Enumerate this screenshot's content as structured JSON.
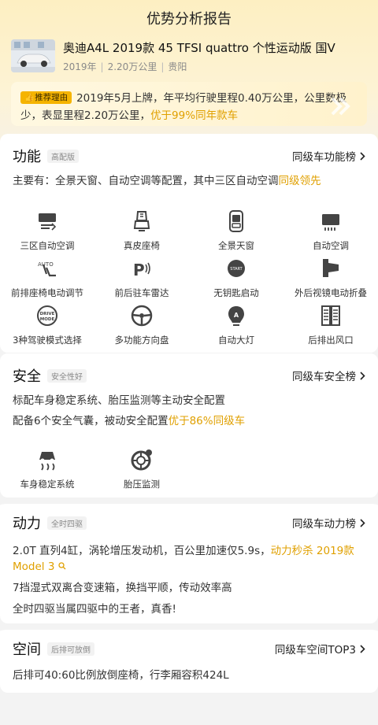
{
  "header": {
    "title": "优势分析报告"
  },
  "car": {
    "name": "奥迪A4L 2019款 45 TFSI quattro 个性运动版 国V",
    "year": "2019年",
    "mileage": "2.20万公里",
    "city": "贵阳"
  },
  "reason": {
    "badge": "推荐理由",
    "text": "2019年5月上牌，年平均行驶里程0.40万公里，公里数极少，表显里程2.20万公里，",
    "highlight": "优于99%同年款车"
  },
  "function": {
    "title": "功能",
    "tag": "高配版",
    "link": "同级车功能榜",
    "desc": "主要有：全景天窗、自动空调等配置，其中三区自动空调",
    "desc_highlight": "同级领先",
    "features": [
      {
        "label": "三区自动空调",
        "icon": "tri-zone-ac-icon"
      },
      {
        "label": "真皮座椅",
        "icon": "leather-seat-icon"
      },
      {
        "label": "全景天窗",
        "icon": "panoramic-sunroof-icon"
      },
      {
        "label": "自动空调",
        "icon": "auto-ac-icon"
      },
      {
        "label": "前排座椅电动调节",
        "icon": "power-seat-icon"
      },
      {
        "label": "前后驻车雷达",
        "icon": "parking-radar-icon"
      },
      {
        "label": "无钥匙启动",
        "icon": "keyless-start-icon"
      },
      {
        "label": "外后视镜电动折叠",
        "icon": "mirror-fold-icon"
      },
      {
        "label": "3种驾驶模式选择",
        "icon": "drive-mode-icon"
      },
      {
        "label": "多功能方向盘",
        "icon": "steering-wheel-icon"
      },
      {
        "label": "自动大灯",
        "icon": "auto-headlight-icon"
      },
      {
        "label": "后排出风口",
        "icon": "rear-vent-icon"
      }
    ],
    "icon_text": {
      "auto": "AUTO",
      "p": "P",
      "start": "START",
      "drive": "DRIVE",
      "mode": "MODE",
      "a": "A"
    }
  },
  "safety": {
    "title": "安全",
    "tag": "安全性好",
    "link": "同级车安全榜",
    "desc1": "标配车身稳定系统、胎压监测等主动安全配置",
    "desc2": "配备6个安全气囊，被动安全配置",
    "desc2_highlight": "优于86%同级车",
    "features": [
      {
        "label": "车身稳定系统",
        "icon": "esp-icon"
      },
      {
        "label": "胎压监测",
        "icon": "tire-pressure-icon"
      }
    ]
  },
  "power": {
    "title": "动力",
    "tag": "全时四驱",
    "link": "同级车动力榜",
    "desc1": "2.0T 直列4缸，涡轮增压发动机，百公里加速仅5.9s，",
    "desc1_highlight": "动力秒杀 2019款",
    "desc1_line2": "Model 3",
    "desc2": "7挡湿式双离合变速箱，换挡平顺，传动效率高",
    "desc3": "全时四驱当属四驱中的王者，真香!"
  },
  "space": {
    "title": "空间",
    "tag": "后排可放倒",
    "link": "同级车空间TOP3",
    "desc": "后排可40:60比例放倒座椅，行李厢容积424L"
  },
  "colors": {
    "accent": "#e0a000",
    "badge": "#f5b400",
    "icon": "#444444"
  }
}
